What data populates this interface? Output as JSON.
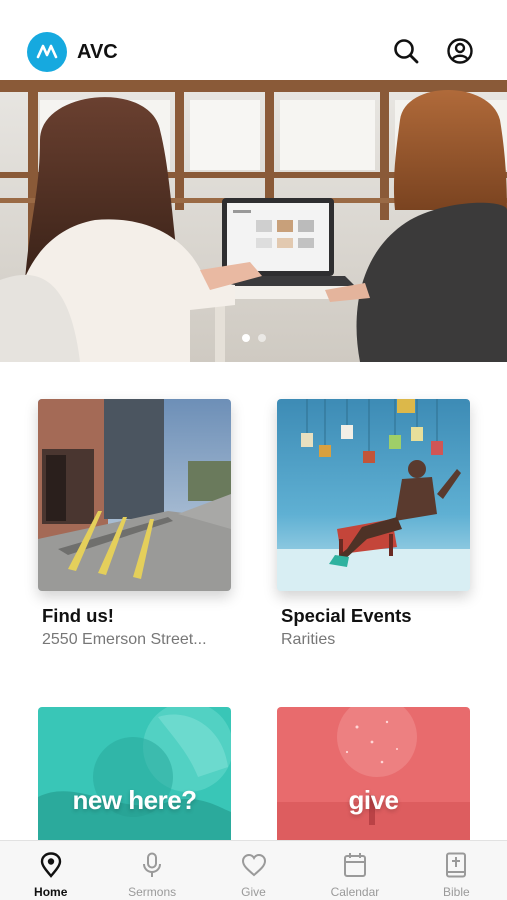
{
  "header": {
    "app_name": "AVC",
    "logo_icon": "avc-logo-icon",
    "brand_color": "#16a9df",
    "search_icon": "search-icon",
    "account_icon": "account-circle-icon"
  },
  "hero": {
    "carousel_slide_count": 2,
    "carousel_active_index": 0
  },
  "cards": [
    {
      "title": "Find us!",
      "subtitle": "2550 Emerson Street..."
    },
    {
      "title": "Special Events",
      "subtitle": "Rarities"
    }
  ],
  "promos": [
    {
      "label": "new here?",
      "tint": "#39c6b7"
    },
    {
      "label": "give",
      "tint": "#e86b6d"
    }
  ],
  "tabbar": {
    "active_index": 0,
    "tabs": [
      {
        "label": "Home",
        "icon": "location-pin-icon"
      },
      {
        "label": "Sermons",
        "icon": "microphone-icon"
      },
      {
        "label": "Give",
        "icon": "heart-icon"
      },
      {
        "label": "Calendar",
        "icon": "calendar-icon"
      },
      {
        "label": "Bible",
        "icon": "bible-icon"
      }
    ]
  }
}
